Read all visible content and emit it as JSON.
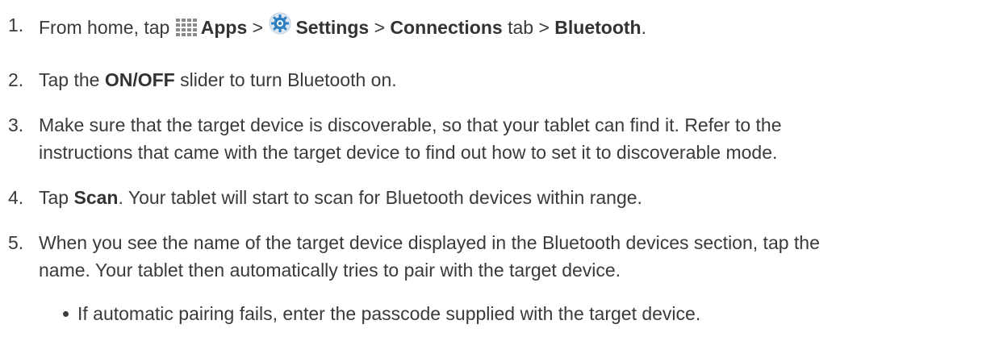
{
  "steps": [
    {
      "number": "1.",
      "intro": "From home, tap ",
      "apps_label": "Apps",
      "sep1": " > ",
      "settings_label": "Settings",
      "sep2": " > ",
      "connections_label": "Connections",
      "tab_text": " tab > ",
      "bluetooth_label": "Bluetooth",
      "end": "."
    },
    {
      "number": "2.",
      "pre": "Tap the ",
      "bold": "ON/OFF",
      "post": " slider to turn Bluetooth on."
    },
    {
      "number": "3.",
      "line1": "Make sure that the target device is discoverable, so that your tablet can find it. Refer to the",
      "line2": "instructions that came with the target device to find out how to set it to discoverable mode."
    },
    {
      "number": "4.",
      "pre": "Tap ",
      "bold": "Scan",
      "post": ". Your tablet will start to scan for Bluetooth devices within range."
    },
    {
      "number": "5.",
      "line1": "When you see the name of the target device displayed in the Bluetooth devices section, tap the",
      "line2": "name. Your tablet then automatically tries to pair with the target device."
    }
  ],
  "bullets": [
    "If automatic pairing fails, enter the passcode supplied with the target device."
  ],
  "icons": {
    "apps": "apps-grid-icon",
    "settings": "settings-gear-icon"
  },
  "colors": {
    "text": "#3a3a3a",
    "gear_blue": "#2f7fc1"
  }
}
